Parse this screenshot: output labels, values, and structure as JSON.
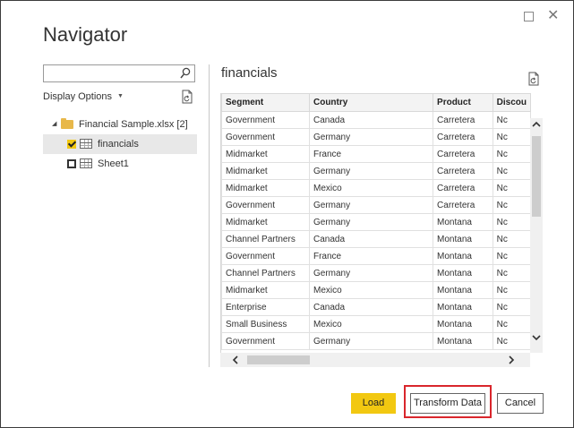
{
  "window": {
    "title": "Navigator"
  },
  "search": {
    "value": "",
    "placeholder": ""
  },
  "display_options": {
    "label": "Display Options"
  },
  "tree": {
    "file": {
      "label": "Financial Sample.xlsx [2]",
      "icon": "folder-icon"
    },
    "items": [
      {
        "label": "financials",
        "checked": true
      },
      {
        "label": "Sheet1",
        "checked": false
      }
    ]
  },
  "preview": {
    "title": "financials",
    "columns": [
      "Segment",
      "Country",
      "Product",
      "Discou"
    ],
    "rows": [
      [
        "Government",
        "Canada",
        "Carretera",
        "Nc"
      ],
      [
        "Government",
        "Germany",
        "Carretera",
        "Nc"
      ],
      [
        "Midmarket",
        "France",
        "Carretera",
        "Nc"
      ],
      [
        "Midmarket",
        "Germany",
        "Carretera",
        "Nc"
      ],
      [
        "Midmarket",
        "Mexico",
        "Carretera",
        "Nc"
      ],
      [
        "Government",
        "Germany",
        "Carretera",
        "Nc"
      ],
      [
        "Midmarket",
        "Germany",
        "Montana",
        "Nc"
      ],
      [
        "Channel Partners",
        "Canada",
        "Montana",
        "Nc"
      ],
      [
        "Government",
        "France",
        "Montana",
        "Nc"
      ],
      [
        "Channel Partners",
        "Germany",
        "Montana",
        "Nc"
      ],
      [
        "Midmarket",
        "Mexico",
        "Montana",
        "Nc"
      ],
      [
        "Enterprise",
        "Canada",
        "Montana",
        "Nc"
      ],
      [
        "Small Business",
        "Mexico",
        "Montana",
        "Nc"
      ],
      [
        "Government",
        "Germany",
        "Montana",
        "Nc"
      ]
    ]
  },
  "buttons": {
    "load": "Load",
    "transform": "Transform Data",
    "cancel": "Cancel"
  },
  "colors": {
    "accent": "#f2c811",
    "highlight": "#d9262c",
    "folder": "#e8b84a"
  }
}
